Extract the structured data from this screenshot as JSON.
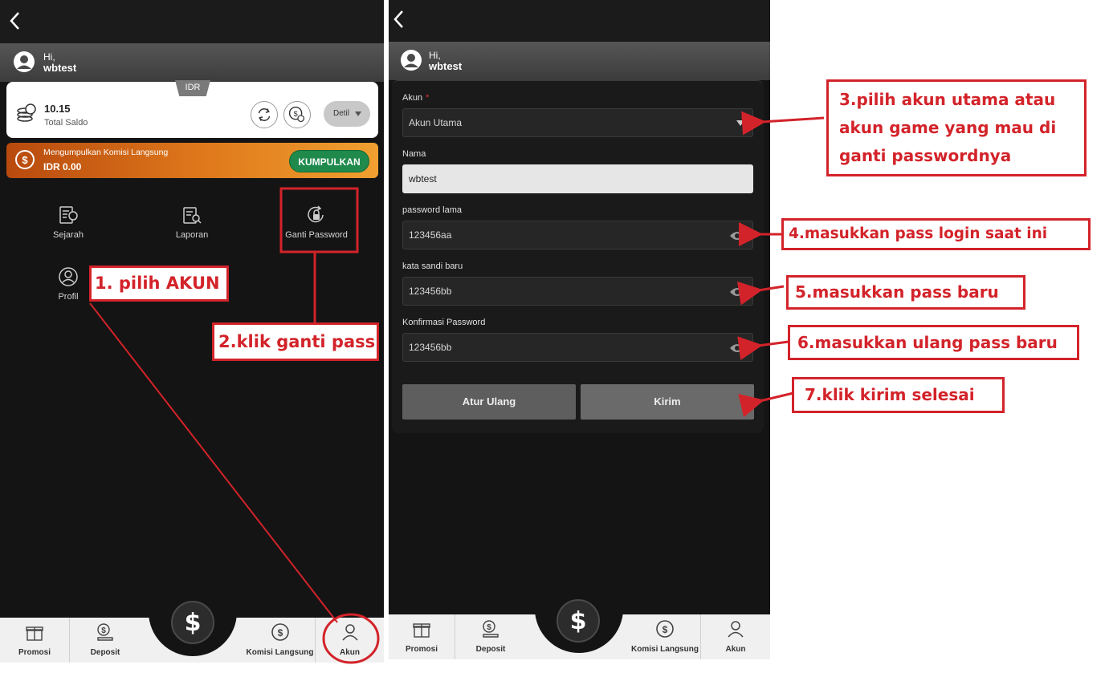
{
  "left_panel": {
    "greeting": "Hi,",
    "username": "wbtest",
    "balance": {
      "currency": "IDR",
      "amount": "10.15",
      "label": "Total Saldo",
      "detail_label": "Detil"
    },
    "commission": {
      "label": "Mengumpulkan Komisi Langsung",
      "amount": "IDR 0.00",
      "button_label": "KUMPULKAN"
    },
    "menu": {
      "sejarah": "Sejarah",
      "laporan": "Laporan",
      "ganti_password": "Ganti Password",
      "profil": "Profil"
    }
  },
  "right_panel": {
    "greeting": "Hi,",
    "username": "wbtest",
    "form": {
      "akun_label": "Akun",
      "akun_required": "*",
      "akun_value": "Akun Utama",
      "nama_label": "Nama",
      "nama_value": "wbtest",
      "old_password_label": "password lama",
      "old_password_value": "123456aa",
      "new_password_label": "kata sandi baru",
      "new_password_value": "123456bb",
      "confirm_password_label": "Konfirmasi Password",
      "confirm_password_value": "123456bb",
      "reset_button": "Atur Ulang",
      "submit_button": "Kirim"
    }
  },
  "bottom_nav": {
    "promosi": "Promosi",
    "deposit": "Deposit",
    "center_symbol": "$",
    "komisi": "Komisi Langsung",
    "akun": "Akun"
  },
  "annotations": {
    "step1": "1. pilih AKUN",
    "step2": "2.klik ganti pass",
    "step3_line1": "3.pilih akun utama atau",
    "step3_line2": "akun game yang mau di",
    "step3_line3": "ganti passwordnya",
    "step4": "4.masukkan pass login saat ini",
    "step5": "5.masukkan pass baru",
    "step6": "6.masukkan ulang pass baru",
    "step7": "7.klik kirim selesai"
  },
  "colors": {
    "annotation_red": "#d3232a",
    "app_background": "#141414",
    "commission_orange": "#e07a1c",
    "kumpulkan_green": "#1f8a4c"
  }
}
